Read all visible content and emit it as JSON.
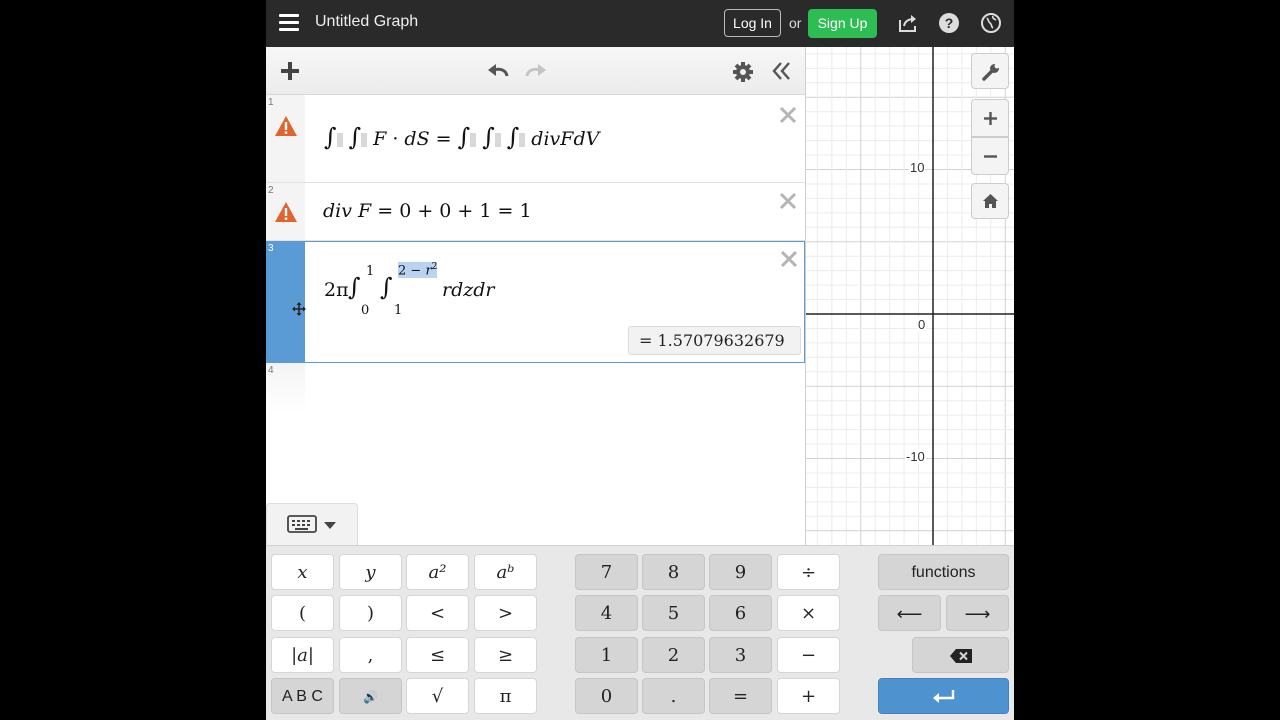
{
  "header": {
    "title": "Untitled Graph",
    "login_label": "Log In",
    "or_label": "or",
    "signup_label": "Sign Up",
    "icons": [
      "menu-icon",
      "share-icon",
      "help-icon",
      "globe-icon"
    ]
  },
  "toolbar": {
    "icons": [
      "add-icon",
      "undo-icon",
      "redo-icon",
      "settings-gear-icon",
      "collapse-panel-icon"
    ]
  },
  "expressions": [
    {
      "number": "1",
      "warning": true,
      "latex_text": "∫∫F · dS = ∫∫∫divFdV"
    },
    {
      "number": "2",
      "warning": true,
      "latex_text": "div F = 0 + 0 + 1 = 1"
    },
    {
      "number": "3",
      "warning": false,
      "selected": true,
      "latex_text": "2π ∫₀¹ ∫₁^{2−r²} rdzdr",
      "result": "= 1.57079632679"
    },
    {
      "number": "4",
      "warning": false,
      "latex_text": ""
    }
  ],
  "graph": {
    "tick_labels": {
      "y_pos": "10",
      "zero": "0",
      "y_neg": "-10"
    },
    "tool_icons": [
      "wrench-icon",
      "zoom-in-icon",
      "zoom-out-icon",
      "home-icon"
    ]
  },
  "keypad": {
    "left": [
      "x",
      "y",
      "a²",
      "aᵇ",
      "(",
      ")",
      "<",
      ">",
      "|a|",
      ",",
      "≤",
      "≥",
      "A B C",
      "🔊",
      "√",
      "π"
    ],
    "middle": [
      "7",
      "8",
      "9",
      "÷",
      "4",
      "5",
      "6",
      "×",
      "1",
      "2",
      "3",
      "−",
      "0",
      ".",
      "=",
      "+"
    ],
    "functions_label": "functions",
    "left_arrow": "⟵",
    "right_arrow": "⟶",
    "enter_icon": "enter-icon",
    "backspace_icon": "backspace-icon"
  },
  "colors": {
    "header_bg": "#2a2a2a",
    "signup_green": "#2dbd52",
    "warning_orange": "#e0642e",
    "selection_blue": "#5a9bd5",
    "enter_blue": "#4e93cf"
  }
}
